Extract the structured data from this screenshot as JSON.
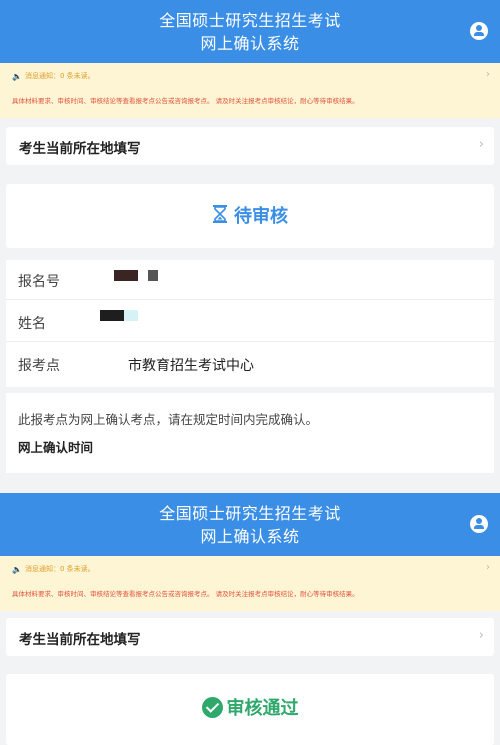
{
  "screen1": {
    "header": {
      "title_line1": "全国硕士研究生招生考试",
      "title_line2": "网上确认系统"
    },
    "notice": {
      "message": "消息通知：0 条未读。",
      "detail": "具体材料要求、审核时间、审核结论等查看报考点公告或咨询报考点。 请及时关注报考点审核结论，耐心等待审核结果。"
    },
    "location_row": {
      "label": "考生当前所在地填写"
    },
    "status": {
      "label": "待审核"
    },
    "info": {
      "rows": [
        {
          "key": "报名号",
          "value": ""
        },
        {
          "key": "姓名",
          "value": ""
        },
        {
          "key": "报考点",
          "value": "市教育招生考试中心"
        }
      ]
    },
    "description": {
      "message": "此报考点为网上确认考点，请在规定时间内完成确认。",
      "confirm_time_label": "网上确认时间"
    }
  },
  "screen2": {
    "header": {
      "title_line1": "全国硕士研究生招生考试",
      "title_line2": "网上确认系统"
    },
    "notice": {
      "message": "消息通知：0 条未读。",
      "detail": "具体材料要求、审核时间、审核结论等查看报考点公告或咨询报考点。 请及时关注报考点审核结论，耐心等待审核结果。"
    },
    "location_row": {
      "label": "考生当前所在地填写"
    },
    "status": {
      "label": "审核通过"
    }
  },
  "colors": {
    "header_blue": "#3a8ee6",
    "notice_bg": "#fdf5d3",
    "notice_orange": "#e19e2c",
    "notice_red": "#e4523f",
    "pending_blue": "#3a8ee6",
    "passed_green": "#2ea86b"
  },
  "icons": [
    "user-icon",
    "speaker-icon",
    "chevron-right-icon",
    "hourglass-icon",
    "check-circle-icon"
  ]
}
